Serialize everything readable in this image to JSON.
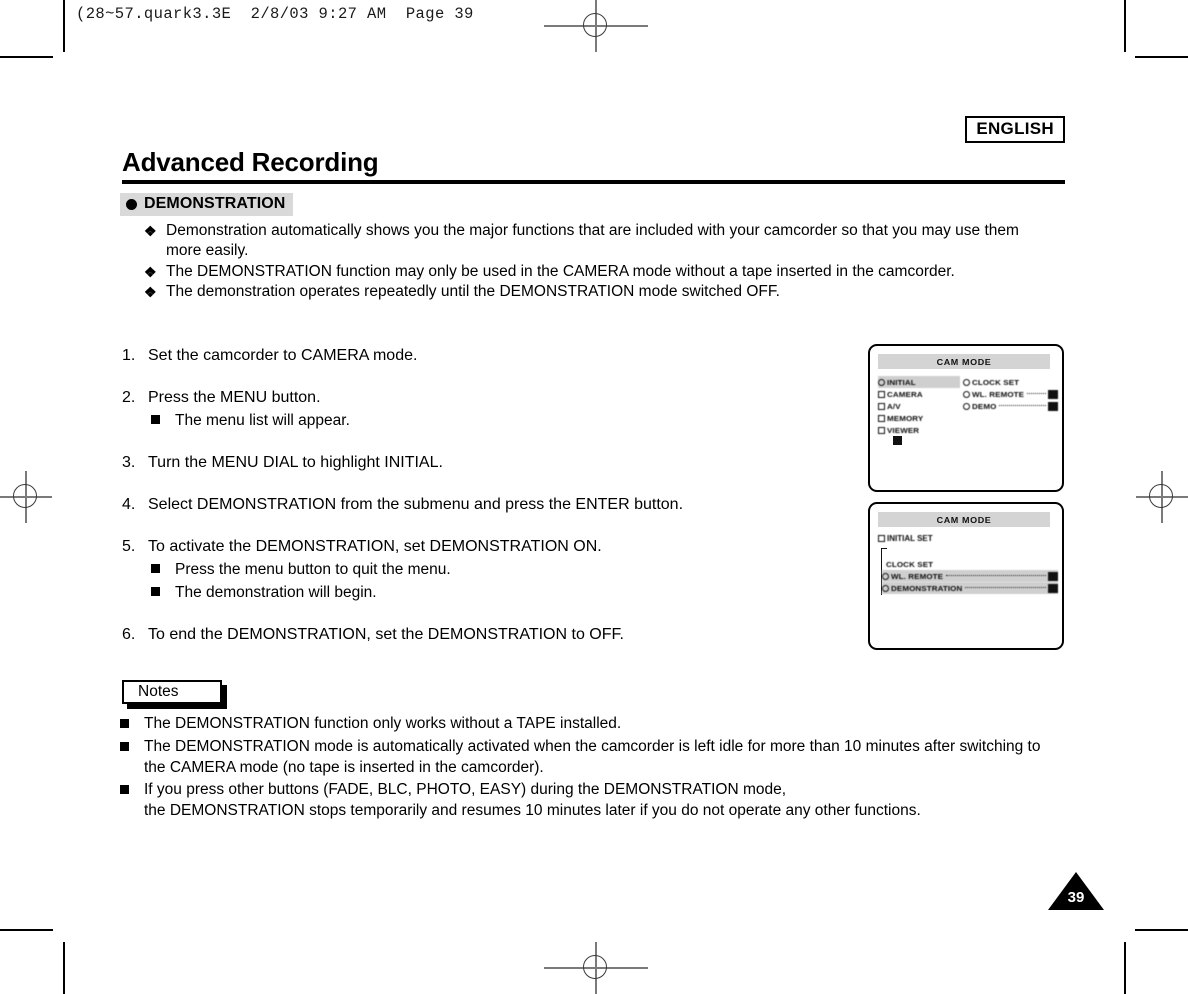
{
  "print_header": "(28~57.quark3.3E  2/8/03 9:27 AM  Page 39",
  "language_tag": "ENGLISH",
  "page_title": "Advanced Recording",
  "section": {
    "heading": "DEMONSTRATION",
    "bullet_icon": "filled-circle-bullet",
    "intro_marker": "❖",
    "intro_items": [
      "Demonstration automatically shows you the major functions that are included with your camcorder so that you may use them more easily.",
      "The DEMONSTRATION function may only be used in the CAMERA mode without a tape inserted in the camcorder.",
      "The demonstration operates repeatedly until the DEMONSTRATION mode switched OFF."
    ]
  },
  "steps": [
    {
      "num": "1.",
      "text": "Set the camcorder to CAMERA mode.",
      "subs": []
    },
    {
      "num": "2.",
      "text": "Press the MENU button.",
      "subs": [
        "The menu list will appear."
      ]
    },
    {
      "num": "3.",
      "text": "Turn the MENU DIAL to highlight INITIAL.",
      "subs": []
    },
    {
      "num": "4.",
      "text": "Select DEMONSTRATION from the submenu and press the ENTER button.",
      "subs": []
    },
    {
      "num": "5.",
      "text": "To activate the DEMONSTRATION, set DEMONSTRATION ON.",
      "subs": [
        "Press the menu button to quit the menu.",
        "The demonstration will begin."
      ]
    },
    {
      "num": "6.",
      "text": "To end the DEMONSTRATION, set the DEMONSTRATION to OFF.",
      "subs": []
    }
  ],
  "lcd_screens": [
    {
      "title": "CAM MODE",
      "left_items": [
        "INITIAL",
        "CAMERA",
        "A/V",
        "MEMORY",
        "VIEWER"
      ],
      "right_items": [
        "CLOCK SET",
        "WL. REMOTE",
        "DEMO"
      ]
    },
    {
      "title": "CAM MODE",
      "header": "INITIAL SET",
      "items": [
        "CLOCK SET",
        "WL. REMOTE",
        "DEMONSTRATION"
      ]
    }
  ],
  "notes": {
    "label": "Notes",
    "items": [
      "The DEMONSTRATION function only works without a TAPE installed.",
      "The DEMONSTRATION mode is automatically activated when the camcorder is left idle for more than 10 minutes after switching to the CAMERA mode (no tape is inserted in the camcorder).",
      "If you press other buttons (FADE, BLC, PHOTO, EASY) during the DEMONSTRATION mode,\nthe DEMONSTRATION stops temporarily and resumes 10 minutes later if you do not operate any other functions."
    ]
  },
  "page_number": "39",
  "colors": {
    "heading_bg": "#d9d9d9",
    "rule": "#000000",
    "badge": "#000000"
  }
}
